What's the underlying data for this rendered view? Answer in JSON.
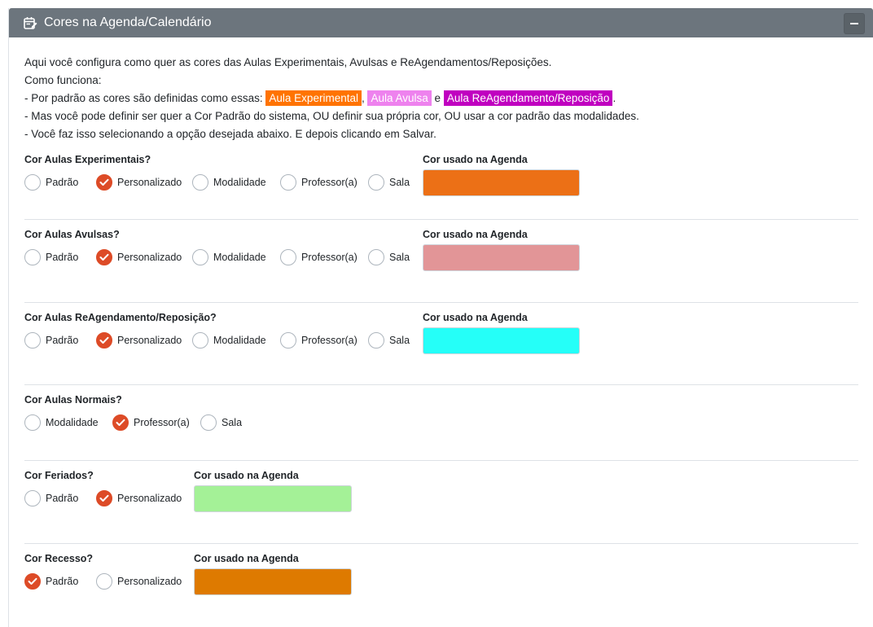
{
  "header": {
    "title": "Cores na Agenda/Calendário",
    "collapse_icon": "minus-icon",
    "title_icon": "calendar-edit-icon"
  },
  "intro": {
    "line1": "Aqui você configura como quer as cores das Aulas Experimentais, Avulsas e ReAgendamentos/Reposições.",
    "line2": "Como funciona:",
    "line3_prefix": "- Por padrão as cores são definidas como essas: ",
    "badge_experimental": "Aula Experimental",
    "sep1": ", ",
    "badge_avulsa": "Aula Avulsa",
    "sep2": " e ",
    "badge_reagendamento": "Aula ReAgendamento/Reposição",
    "line3_suffix": ".",
    "line4": "- Mas você pode definir ser quer a Cor Padrão do sistema, OU definir sua própria cor, OU usar a cor padrão das modalidades.",
    "line5": "- Você faz isso selecionando a opção desejada abaixo. E depois clicando em Salvar."
  },
  "badge_colors": {
    "experimental": "#ff7300",
    "avulsa": "#ee82ee",
    "reagendamento": "#c000c0"
  },
  "sections": [
    {
      "title": "Cor Aulas Experimentais?",
      "options": [
        "Padrão",
        "Personalizado",
        "Modalidade",
        "Professor(a)",
        "Sala"
      ],
      "selected": "Personalizado",
      "color_label": "Cor usado na Agenda",
      "color": "#ec7016"
    },
    {
      "title": "Cor Aulas Avulsas?",
      "options": [
        "Padrão",
        "Personalizado",
        "Modalidade",
        "Professor(a)",
        "Sala"
      ],
      "selected": "Personalizado",
      "color_label": "Cor usado na Agenda",
      "color": "#e29597"
    },
    {
      "title": "Cor Aulas ReAgendamento/Reposição?",
      "options": [
        "Padrão",
        "Personalizado",
        "Modalidade",
        "Professor(a)",
        "Sala"
      ],
      "selected": "Personalizado",
      "color_label": "Cor usado na Agenda",
      "color": "#25fff8"
    },
    {
      "title": "Cor Aulas Normais?",
      "options": [
        "Modalidade",
        "Professor(a)",
        "Sala"
      ],
      "selected": "Professor(a)"
    },
    {
      "title": "Cor Feriados?",
      "options": [
        "Padrão",
        "Personalizado"
      ],
      "selected": "Personalizado",
      "color_label": "Cor usado na Agenda",
      "color": "#a4f197"
    },
    {
      "title": "Cor Recesso?",
      "options": [
        "Padrão",
        "Personalizado"
      ],
      "selected": "Padrão",
      "color_label": "Cor usado na Agenda",
      "color": "#de7a00"
    }
  ]
}
